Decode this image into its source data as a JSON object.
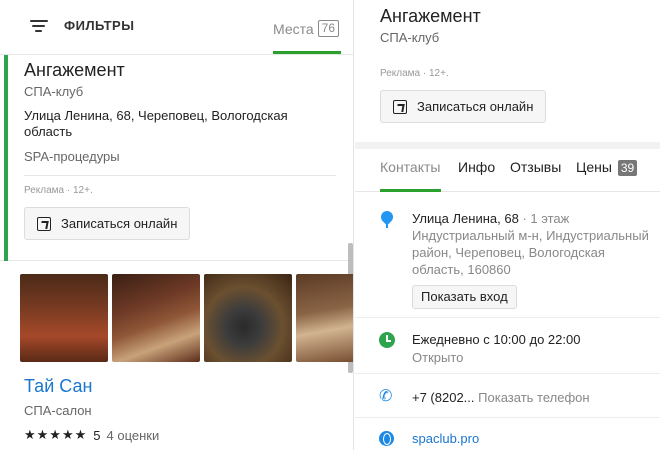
{
  "left": {
    "filter_label": "ФИЛЬТРЫ",
    "places_label": "Места",
    "places_count": "76",
    "card1": {
      "title": "Ангажемент",
      "category": "СПА-клуб",
      "address": "Улица Ленина, 68, Череповец, Вологодская область",
      "services": "SPA-процедуры",
      "ad_text": "Реклама · 12+.",
      "book_label": "Записаться онлайн"
    },
    "card2": {
      "title": "Тай Сан",
      "category": "СПА-салон",
      "stars": "★★★★★",
      "rating": "5",
      "ratings_count": "4 оценки"
    }
  },
  "right": {
    "title": "Ангажемент",
    "category": "СПА-клуб",
    "ad_text": "Реклама · 12+.",
    "book_label": "Записаться онлайн",
    "tabs": {
      "contacts": "Контакты",
      "info": "Инфо",
      "reviews": "Отзывы",
      "prices": "Цены",
      "prices_count": "39"
    },
    "address": {
      "line1": "Улица Ленина, 68",
      "floor": " · 1 этаж",
      "details": "Индустриальный м-н, Индустриальный район, Череповец, Вологодская область, 160860",
      "entrance_label": "Показать вход"
    },
    "hours": {
      "schedule": "Ежедневно с 10:00 до 22:00",
      "status": "Открыто"
    },
    "phone": {
      "number": "+7 (8202...",
      "show_label": "Показать телефон"
    },
    "website": "spaclub.pro"
  },
  "colors": {
    "accent_green": "#2ea44f",
    "link_blue": "#1976d2"
  }
}
